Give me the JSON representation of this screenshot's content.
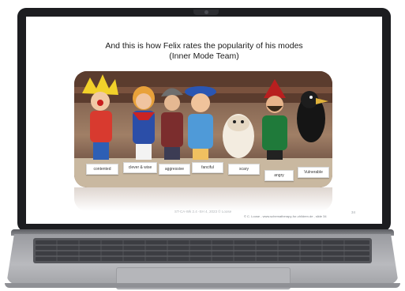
{
  "slide": {
    "title": "And this is how Felix rates the popularity of his modes",
    "subtitle": "(Inner Mode Team)",
    "labels": [
      "contented",
      "clever & wise",
      "aggressive",
      "fanciful",
      "scary",
      "angry",
      "Vulnerable"
    ],
    "footer_left": "ST-CA-Wk 2.4 -SH 4, 2023 © Loose",
    "footer_right": "© C. Loose - www.schematherapy-for-children.de , slide 34",
    "page_number": "34"
  },
  "colors": {
    "bezel": "#1c1d20",
    "laptop_body": "#a9aaae",
    "slide_background": "#ffffff"
  }
}
